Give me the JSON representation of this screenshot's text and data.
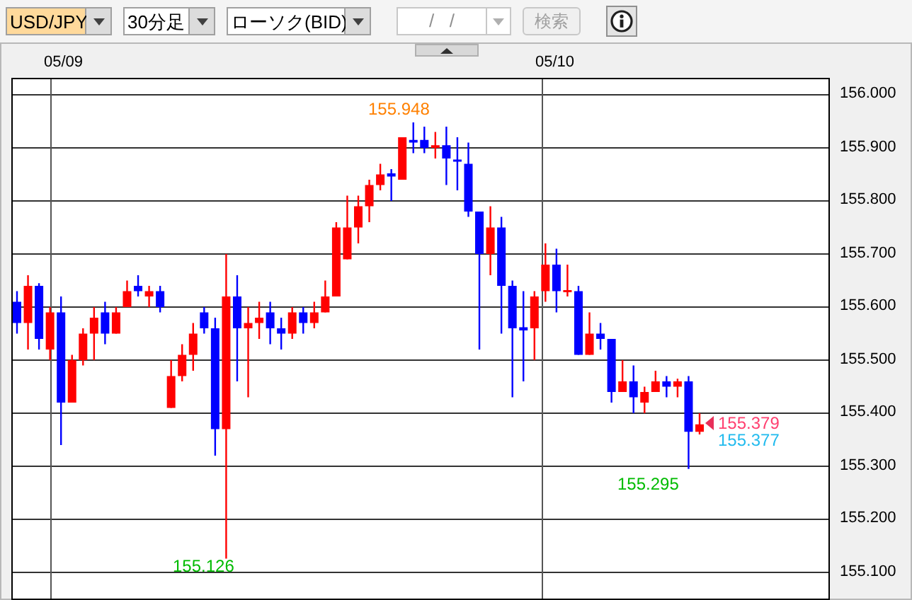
{
  "toolbar": {
    "symbol": {
      "value": "USD/JPY",
      "focused": true
    },
    "timeframe": {
      "value": "30分足"
    },
    "chart_type": {
      "value": "ローソク(BID)"
    },
    "date_field": {
      "placeholder": "/ /",
      "disabled": true
    },
    "search_button": {
      "label": "検索",
      "disabled": true
    }
  },
  "chart": {
    "x_labels": [
      "05/09",
      "05/10"
    ],
    "y_labels": [
      "156.000",
      "155.900",
      "155.800",
      "155.700",
      "155.600",
      "155.500",
      "155.400",
      "155.300",
      "155.200",
      "155.100"
    ],
    "high_label": "155.948",
    "low_labels": [
      "155.126",
      "155.295"
    ],
    "ask_label": "155.379",
    "bid_label": "155.377"
  }
}
